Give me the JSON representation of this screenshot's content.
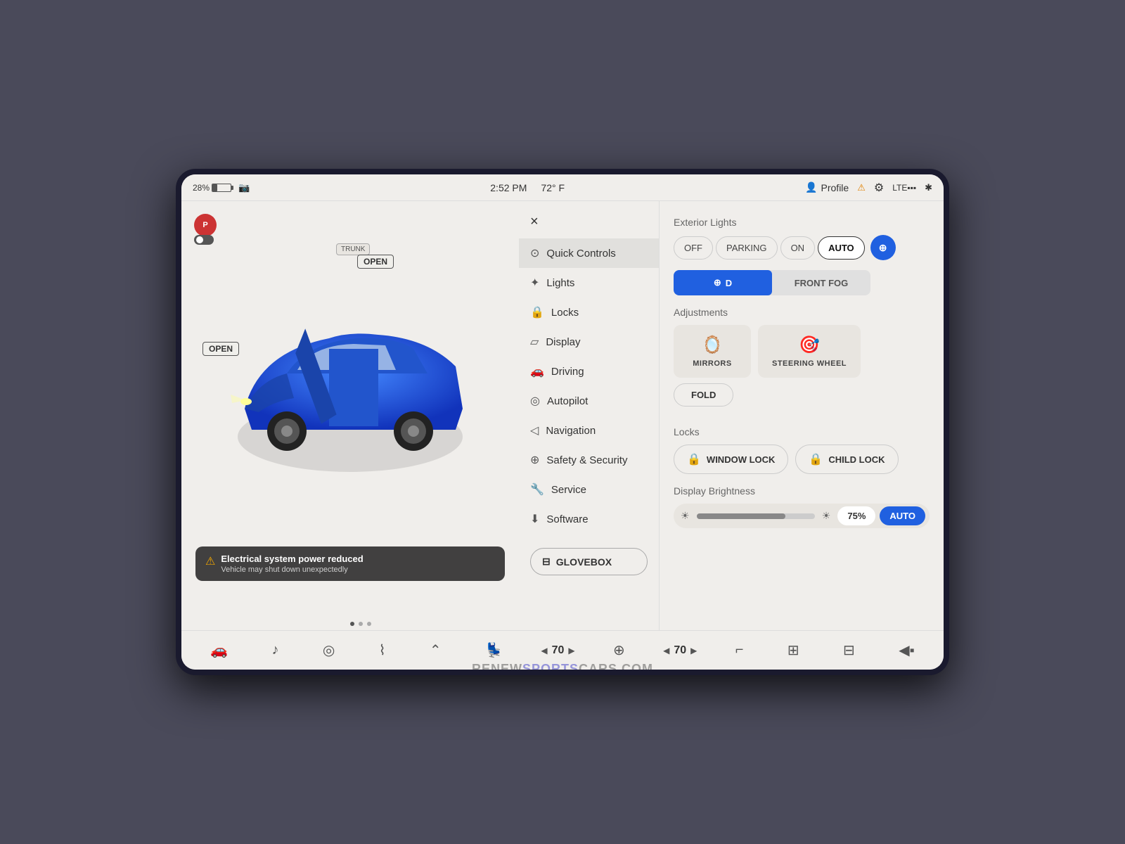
{
  "statusBar": {
    "battery": "28%",
    "time": "2:52 PM",
    "temp": "72° F",
    "profile": "Profile",
    "lte": "LTE"
  },
  "menu": {
    "closeLabel": "×",
    "items": [
      {
        "id": "quick-controls",
        "label": "Quick Controls",
        "icon": "⊙",
        "active": true
      },
      {
        "id": "lights",
        "label": "Lights",
        "icon": "✦"
      },
      {
        "id": "locks",
        "label": "Locks",
        "icon": "🔒"
      },
      {
        "id": "display",
        "label": "Display",
        "icon": "▱"
      },
      {
        "id": "driving",
        "label": "Driving",
        "icon": "🚗"
      },
      {
        "id": "autopilot",
        "label": "Autopilot",
        "icon": "◎"
      },
      {
        "id": "navigation",
        "label": "Navigation",
        "icon": "◁"
      },
      {
        "id": "safety",
        "label": "Safety & Security",
        "icon": "⊕"
      },
      {
        "id": "service",
        "label": "Service",
        "icon": "🔧"
      },
      {
        "id": "software",
        "label": "Software",
        "icon": "⬇"
      }
    ],
    "glovebox": "GLOVEBOX"
  },
  "controls": {
    "exteriorLightsTitle": "Exterior Lights",
    "lightButtons": [
      "OFF",
      "PARKING",
      "ON",
      "AUTO"
    ],
    "selectedLight": "AUTO",
    "fogButtons": [
      {
        "id": "drl",
        "label": "⊕D",
        "active": true
      },
      {
        "id": "frontfog",
        "label": "FRONT FOG",
        "active": false
      }
    ],
    "adjustmentsTitle": "Adjustments",
    "mirrors": "MIRRORS",
    "steeringWheel": "STEERING WHEEL",
    "fold": "FOLD",
    "locksTitle": "Locks",
    "windowLock": "WINDOW LOCK",
    "childLock": "CHILD LOCK",
    "brightnessTitle": "Display Brightness",
    "brightnessValue": "75%",
    "brightnessAuto": "AUTO"
  },
  "alert": {
    "title": "Electrical system power reduced",
    "desc": "Vehicle may shut down unexpectedly"
  },
  "carLabels": {
    "trunk": "TRUNK",
    "trunkOpen": "OPEN",
    "frunkOpen": "OPEN"
  },
  "bottomBar": {
    "temp1": "70",
    "temp2": "70"
  },
  "watermark": {
    "renew": "RENEW",
    "sports": "SPORTS",
    "cars": "CARS.COM"
  }
}
